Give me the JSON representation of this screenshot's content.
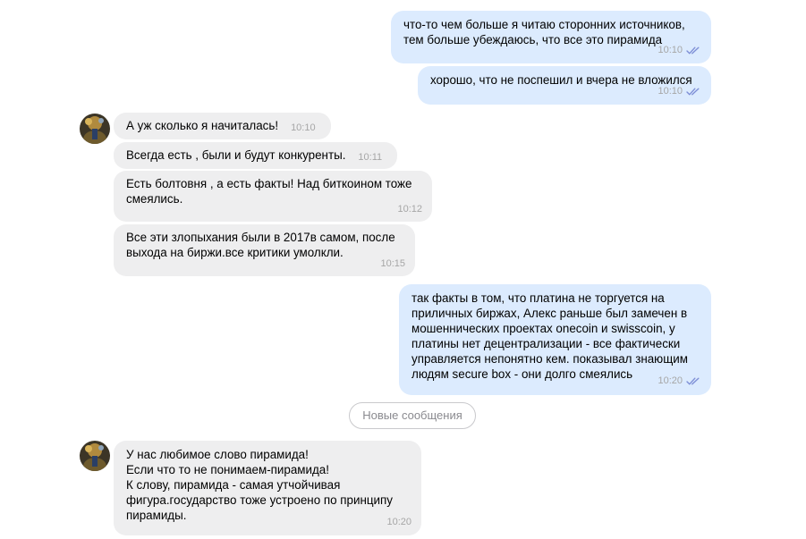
{
  "messages": [
    {
      "direction": "out",
      "text": "что-то чем больше я читаю сторонних источников,\nтем больше убеждаюсь, что все это пирамида",
      "time": "10:10",
      "status": "read"
    },
    {
      "direction": "out",
      "text": "хорошо, что не поспешил и вчера не вложился",
      "time": "10:10",
      "status": "read"
    },
    {
      "direction": "in",
      "text": "А уж сколько я начиталась!",
      "time": "10:10"
    },
    {
      "direction": "in",
      "text": "Всегда есть , были и будут конкуренты.",
      "time": "10:11"
    },
    {
      "direction": "in",
      "text": "Есть болтовня , а есть факты! Над биткоином тоже\nсмеялись.",
      "time": "10:12"
    },
    {
      "direction": "in",
      "text": "Все эти злопыхания были в 2017в самом, после\nвыхода на биржи.все критики умолкли.",
      "time": "10:15"
    },
    {
      "direction": "out",
      "text": "так факты в том, что платина не торгуется на\nприличных биржах, Алекс раньше был замечен в\nмошеннических проектах onecoin и swisscoin, у\nплатины нет децентрализации - все фактически\nуправляется непонятно кем. показывал знающим\nлюдям secure box - они долго смеялись",
      "time": "10:20",
      "status": "read"
    },
    {
      "direction": "in",
      "text": "У нас любимое слово пирамида!\nЕсли что то не понимаем-пирамида!\nК слову, пирамида - самая утчойчивая\nфигура.государство тоже устроено по принципу\nпирамиды.",
      "time": "10:20"
    }
  ],
  "divider": {
    "label": "Новые сообщения"
  },
  "colors": {
    "outgoing_bubble": "#dcebfe",
    "incoming_bubble": "#eeeeef",
    "read_check": "#7e8fd6",
    "time": "#a6a6a6"
  },
  "icons": {
    "read_status": "double-check-icon"
  }
}
